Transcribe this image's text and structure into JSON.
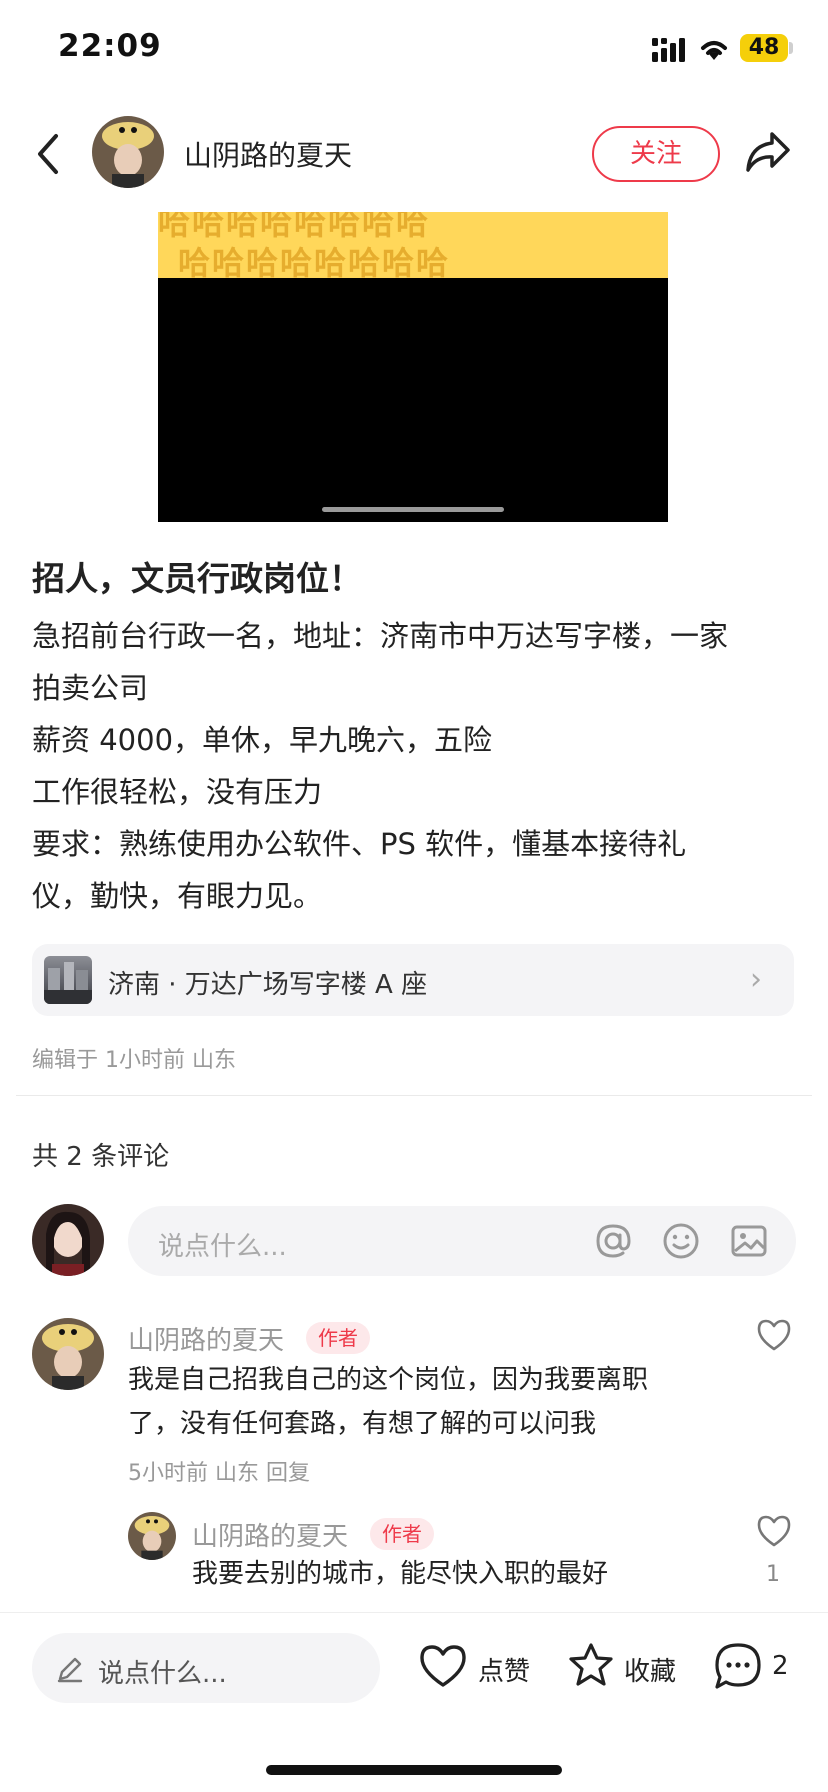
{
  "status_bar": {
    "time": "22:09",
    "battery": "48"
  },
  "header": {
    "author_name": "山阴路的夏天",
    "follow_label": "关注"
  },
  "video": {
    "banner_text": "哈哈哈哈哈哈哈哈"
  },
  "post": {
    "title": "招人，文员行政岗位！",
    "body_lines": [
      "急招前台行政一名，地址：济南市中万达写字楼，一家",
      "拍卖公司",
      "薪资 4000，单休，早九晚六，五险",
      "工作很轻松，没有压力",
      "要求：熟练使用办公软件、PS 软件，懂基本接待礼",
      "仪，勤快，有眼力见。"
    ],
    "location": "济南 · 万达广场写字楼 A 座",
    "edit_meta": "编辑于 1小时前 山东"
  },
  "comments": {
    "count_label": "共 2 条评论",
    "input_placeholder": "说点什么...",
    "items": [
      {
        "author": "山阴路的夏天",
        "badge": "作者",
        "text_lines": [
          "我是自己招我自己的这个岗位，因为我要离职",
          "了，没有任何套路，有想了解的可以问我"
        ],
        "meta": "5小时前 山东 回复"
      },
      {
        "author": "山阴路的夏天",
        "badge": "作者",
        "text_lines": [
          "我要去别的城市，能尽快入职的最好"
        ],
        "likes": "1"
      }
    ]
  },
  "bottom_bar": {
    "input_placeholder": "说点什么...",
    "like_label": "点赞",
    "collect_label": "收藏",
    "comment_count": "2"
  },
  "colors": {
    "accent": "#ee3a4a",
    "video_banner": "#ffd75a"
  },
  "icons": [
    "back-icon",
    "share-icon",
    "signal-icon",
    "wifi-icon",
    "at-icon",
    "emoji-icon",
    "image-icon",
    "heart-icon",
    "star-icon",
    "comment-icon",
    "pencil-icon",
    "chevron-right-icon"
  ]
}
